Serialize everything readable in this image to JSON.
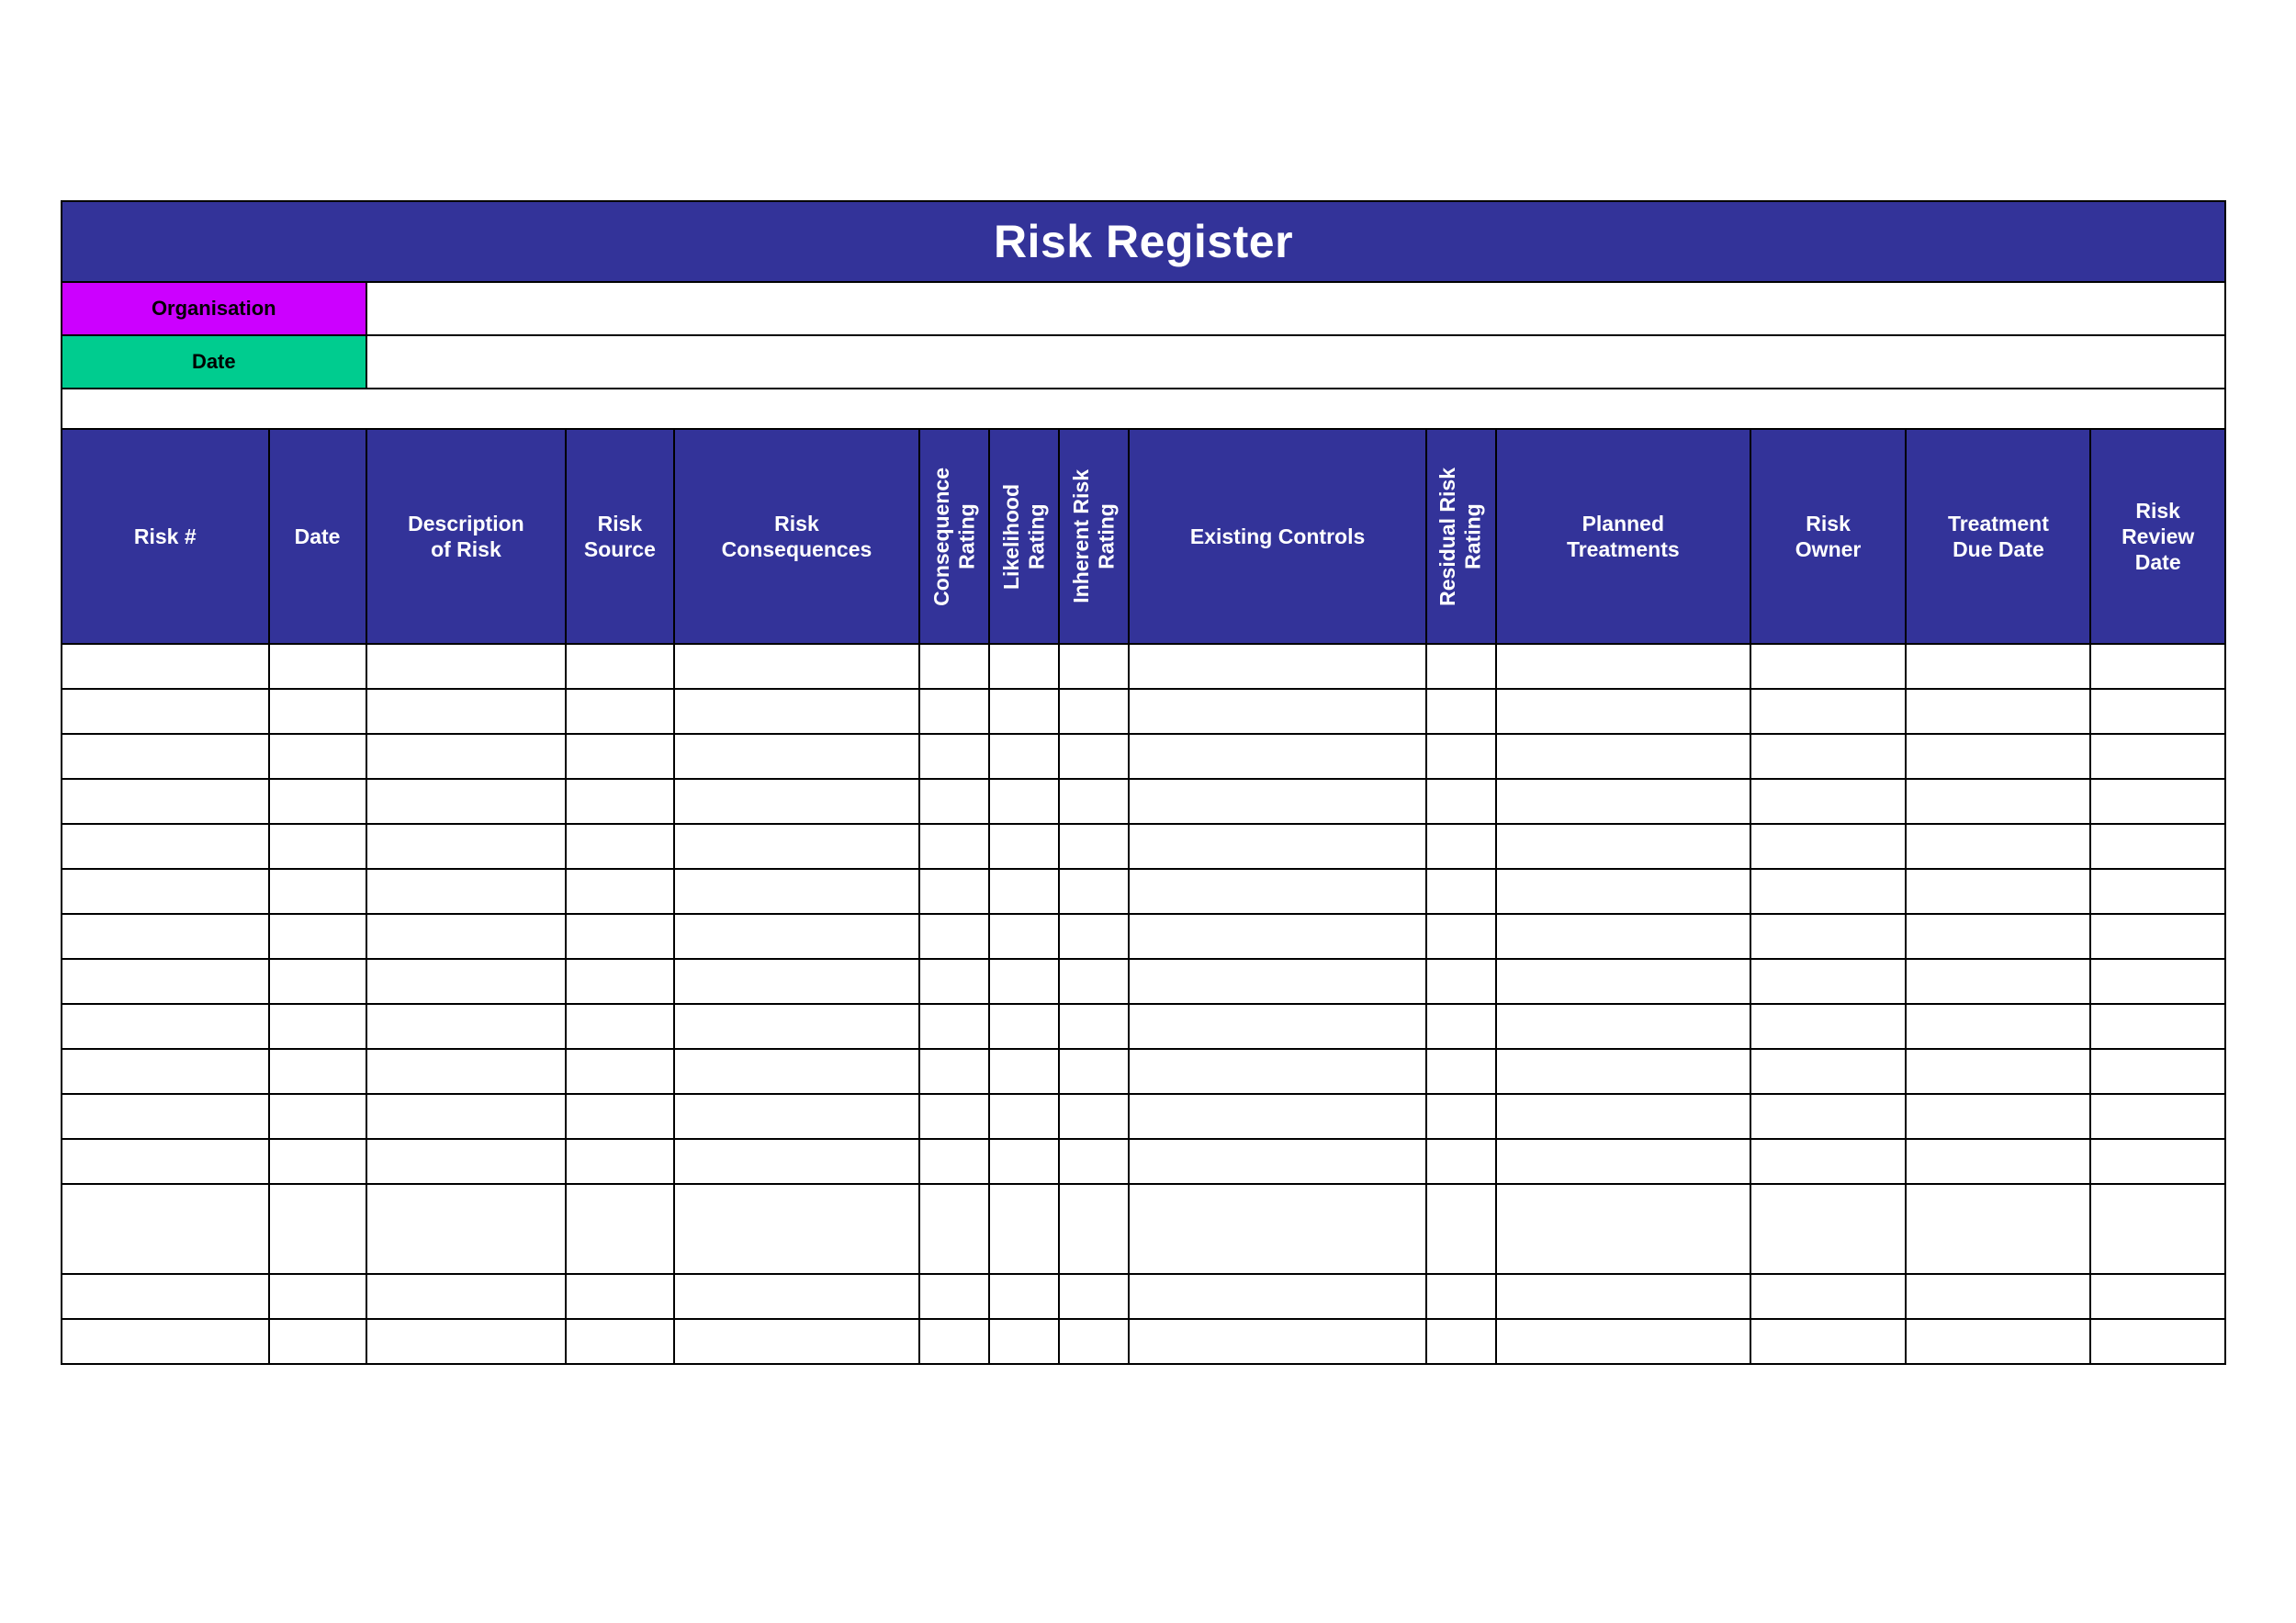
{
  "document": {
    "title": "Risk Register"
  },
  "meta": {
    "fields": [
      {
        "label": "Organisation",
        "value": "",
        "color": "#CC00FF"
      },
      {
        "label": "Date",
        "value": "",
        "color": "#00CC8F"
      }
    ]
  },
  "theme": {
    "header_background": "#333399",
    "header_text": "#FFFFFF",
    "grid_line": "#000000",
    "organisation_fill": "#CC00FF",
    "date_fill": "#00CC8F",
    "page_background": "#FFFFFF"
  },
  "table": {
    "columns": [
      {
        "label": "Risk #",
        "orientation": "horizontal"
      },
      {
        "label": "Date",
        "orientation": "horizontal"
      },
      {
        "label": "Description\nof Risk",
        "orientation": "horizontal"
      },
      {
        "label": "Risk\nSource",
        "orientation": "horizontal"
      },
      {
        "label": "Risk\nConsequences",
        "orientation": "horizontal"
      },
      {
        "label": "Consequence\nRating",
        "orientation": "vertical"
      },
      {
        "label": "Likelihood\nRating",
        "orientation": "vertical"
      },
      {
        "label": "Inherent Risk\nRating",
        "orientation": "vertical"
      },
      {
        "label": "Existing Controls",
        "orientation": "horizontal"
      },
      {
        "label": "Residual Risk\nRating",
        "orientation": "vertical"
      },
      {
        "label": "Planned\nTreatments",
        "orientation": "horizontal"
      },
      {
        "label": "Risk\nOwner",
        "orientation": "horizontal"
      },
      {
        "label": "Treatment\nDue Date",
        "orientation": "horizontal"
      },
      {
        "label": "Risk\nReview\nDate",
        "orientation": "horizontal"
      }
    ],
    "rows": [
      {
        "cells": [
          "",
          "",
          "",
          "",
          "",
          "",
          "",
          "",
          "",
          "",
          "",
          "",
          "",
          ""
        ],
        "tall": false
      },
      {
        "cells": [
          "",
          "",
          "",
          "",
          "",
          "",
          "",
          "",
          "",
          "",
          "",
          "",
          "",
          ""
        ],
        "tall": false
      },
      {
        "cells": [
          "",
          "",
          "",
          "",
          "",
          "",
          "",
          "",
          "",
          "",
          "",
          "",
          "",
          ""
        ],
        "tall": false
      },
      {
        "cells": [
          "",
          "",
          "",
          "",
          "",
          "",
          "",
          "",
          "",
          "",
          "",
          "",
          "",
          ""
        ],
        "tall": false
      },
      {
        "cells": [
          "",
          "",
          "",
          "",
          "",
          "",
          "",
          "",
          "",
          "",
          "",
          "",
          "",
          ""
        ],
        "tall": false
      },
      {
        "cells": [
          "",
          "",
          "",
          "",
          "",
          "",
          "",
          "",
          "",
          "",
          "",
          "",
          "",
          ""
        ],
        "tall": false
      },
      {
        "cells": [
          "",
          "",
          "",
          "",
          "",
          "",
          "",
          "",
          "",
          "",
          "",
          "",
          "",
          ""
        ],
        "tall": false
      },
      {
        "cells": [
          "",
          "",
          "",
          "",
          "",
          "",
          "",
          "",
          "",
          "",
          "",
          "",
          "",
          ""
        ],
        "tall": false
      },
      {
        "cells": [
          "",
          "",
          "",
          "",
          "",
          "",
          "",
          "",
          "",
          "",
          "",
          "",
          "",
          ""
        ],
        "tall": false
      },
      {
        "cells": [
          "",
          "",
          "",
          "",
          "",
          "",
          "",
          "",
          "",
          "",
          "",
          "",
          "",
          ""
        ],
        "tall": false
      },
      {
        "cells": [
          "",
          "",
          "",
          "",
          "",
          "",
          "",
          "",
          "",
          "",
          "",
          "",
          "",
          ""
        ],
        "tall": false
      },
      {
        "cells": [
          "",
          "",
          "",
          "",
          "",
          "",
          "",
          "",
          "",
          "",
          "",
          "",
          "",
          ""
        ],
        "tall": false
      },
      {
        "cells": [
          "",
          "",
          "",
          "",
          "",
          "",
          "",
          "",
          "",
          "",
          "",
          "",
          "",
          ""
        ],
        "tall": true
      },
      {
        "cells": [
          "",
          "",
          "",
          "",
          "",
          "",
          "",
          "",
          "",
          "",
          "",
          "",
          "",
          ""
        ],
        "tall": false
      },
      {
        "cells": [
          "",
          "",
          "",
          "",
          "",
          "",
          "",
          "",
          "",
          "",
          "",
          "",
          "",
          ""
        ],
        "tall": false
      }
    ]
  }
}
